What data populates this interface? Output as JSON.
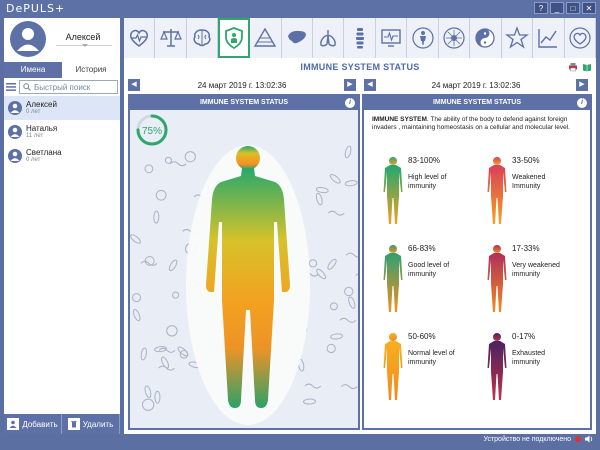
{
  "app": {
    "logo": "DePULS+"
  },
  "window_buttons": [
    "?",
    "_",
    "□",
    "✕"
  ],
  "profile": {
    "name": "Алексей"
  },
  "toolbar": {
    "icons": [
      "heart-pulse-icon",
      "balance-icon",
      "brain-icon",
      "immune-shield-icon",
      "pyramid-icon",
      "liver-icon",
      "lungs-icon",
      "spine-icon",
      "ecg-monitor-icon",
      "body-icon",
      "nerve-icon",
      "yin-yang-icon",
      "star-icon",
      "chart-icon",
      "heart-ring-icon"
    ],
    "active_index": 3
  },
  "sidebar": {
    "tabs": [
      "Имена",
      "История"
    ],
    "active_tab": 0,
    "search_placeholder": "Быстрый поиск",
    "users": [
      {
        "name": "Алексей",
        "age": "0 лет",
        "selected": true
      },
      {
        "name": "Наталья",
        "age": "11 лет",
        "selected": false
      },
      {
        "name": "Светлана",
        "age": "0 лет",
        "selected": false
      }
    ],
    "add_label": "Добавить",
    "delete_label": "Удалить"
  },
  "main": {
    "title": "IMMUNE SYSTEM STATUS",
    "left": {
      "date": "24 март 2019 г. 13:02:36",
      "header": "IMMUNE SYSTEM STATUS",
      "percent": "75%",
      "percent_value": 0.75
    },
    "right": {
      "date": "24 март 2019 г. 13:02:36",
      "header": "IMMUNE SYSTEM STATUS",
      "desc_bold": "IMMUNE SYSTEM",
      "desc_text": ". The ability of the body to defend against foreign invaders , maintaining homeostasis on a cellular and molecular level.",
      "levels": [
        {
          "pct": "83-100%",
          "label": "High level of immunity",
          "color_top": "#22a870",
          "color_bottom": "#f2a020"
        },
        {
          "pct": "33-50%",
          "label": "Weakened Immunity",
          "color_top": "#d8405a",
          "color_bottom": "#f6a020"
        },
        {
          "pct": "66-83%",
          "label": "Good level of immunity",
          "color_top": "#30a070",
          "color_bottom": "#f29020"
        },
        {
          "pct": "17-33%",
          "label": "Very weakened immunity",
          "color_top": "#b0305a",
          "color_bottom": "#f08a20"
        },
        {
          "pct": "50-60%",
          "label": "Normal level of immunity",
          "color_top": "#f6b020",
          "color_bottom": "#f28a20"
        },
        {
          "pct": "0-17%",
          "label": "Exhausted immunity",
          "color_top": "#4a2360",
          "color_bottom": "#c0304a"
        }
      ]
    }
  },
  "status": {
    "text": "Устройство не подключено"
  }
}
